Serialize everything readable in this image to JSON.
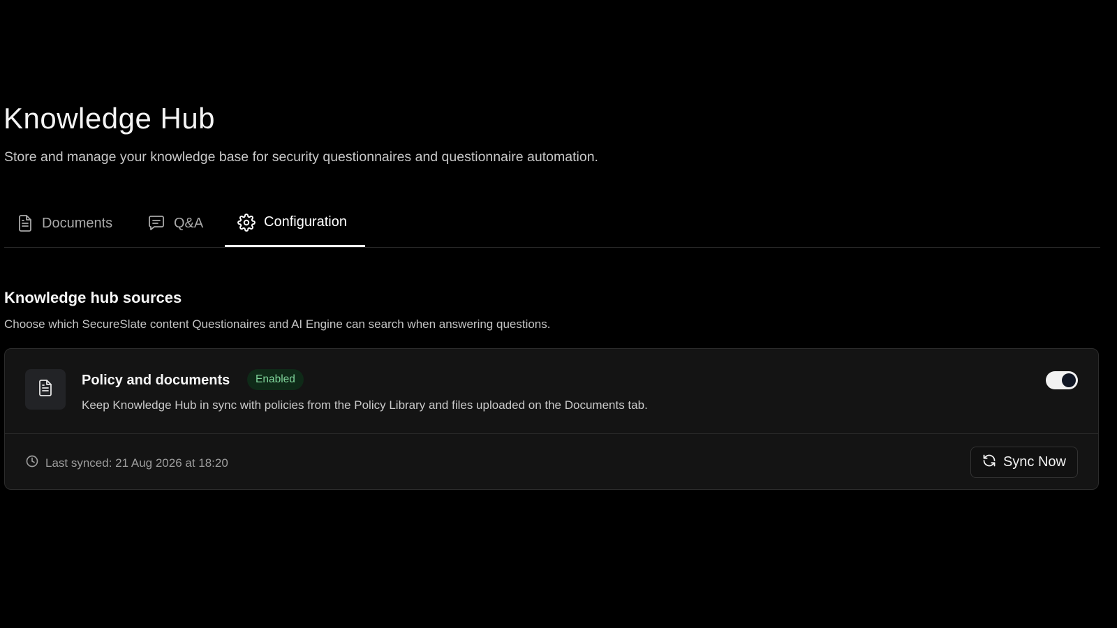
{
  "header": {
    "title": "Knowledge Hub",
    "subtitle": "Store and manage your knowledge base for security questionnaires and questionnaire automation."
  },
  "tabs": [
    {
      "label": "Documents",
      "icon": "document-icon",
      "active": false
    },
    {
      "label": "Q&A",
      "icon": "message-square-icon",
      "active": false
    },
    {
      "label": "Configuration",
      "icon": "gear-icon",
      "active": true
    }
  ],
  "sources_section": {
    "title": "Knowledge hub sources",
    "description": "Choose which SecureSlate content Questionaires and AI Engine can search when answering questions."
  },
  "source": {
    "icon": "document-icon",
    "name": "Policy and documents",
    "status": "Enabled",
    "description": "Keep Knowledge Hub in sync with policies from the Policy Library and files uploaded on the Documents tab.",
    "enabled": true,
    "last_synced": "Last synced: 21 Aug 2026 at 18:20",
    "sync_button_label": "Sync Now"
  },
  "colors": {
    "background": "#000000",
    "card": "#141414",
    "badge_bg": "#0f2a18",
    "badge_text": "#7fd49a",
    "toggle_on": "#f2f2f2"
  }
}
